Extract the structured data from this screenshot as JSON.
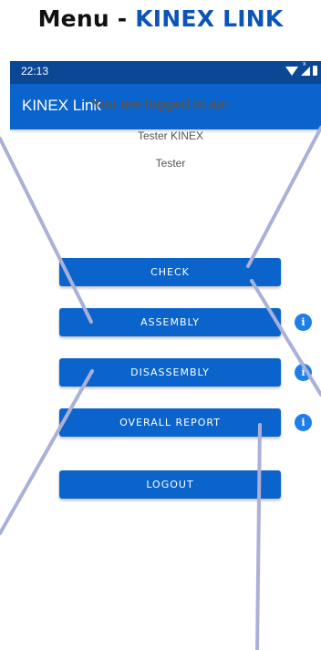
{
  "headline": {
    "prefix": "Menu - ",
    "brand": "KINEX LINK"
  },
  "status_bar": {
    "time": "22:13"
  },
  "app_bar": {
    "title": "KINEX Link"
  },
  "login": {
    "label": "You are logged in as:",
    "name": "Tester KINEX",
    "role": "Tester"
  },
  "menu": {
    "check": "CHECK",
    "assembly": "ASSEMBLY",
    "disassembly": "DISASSEMBLY",
    "overall_report": "OVERALL REPORT",
    "logout": "LOGOUT"
  },
  "info_glyph": "i",
  "colors": {
    "primary": "#0b64cc",
    "status_bar": "#0b4795",
    "brand_text": "#0b55b8",
    "info_icon": "#1f7fe8",
    "callout_line": "#aab0d8"
  },
  "icons": [
    "wifi-icon",
    "signal-icon",
    "battery-icon",
    "info-icon"
  ]
}
